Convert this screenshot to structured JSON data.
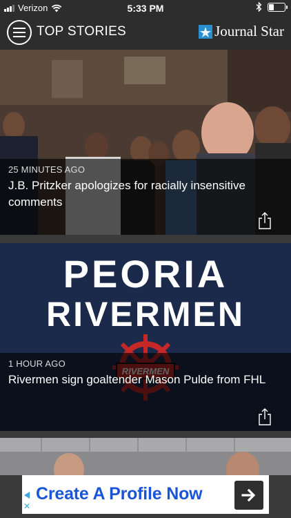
{
  "status_bar": {
    "carrier": "Verizon",
    "time": "5:33 PM",
    "battery_level": 0.35,
    "icons": [
      "signal-icon",
      "wifi-icon",
      "bluetooth-icon",
      "battery-icon"
    ]
  },
  "nav": {
    "title": "TOP STORIES",
    "logo_text": "Journal Star",
    "menu_icon": "hamburger-menu-icon",
    "logo_color": "#2a8fd0"
  },
  "stories": [
    {
      "time_ago": "25 MINUTES AGO",
      "headline": "J.B. Pritzker apologizes for racially insensitive comments",
      "image": "press-conference-photo",
      "share_icon": "share-icon"
    },
    {
      "time_ago": "1 HOUR AGO",
      "headline": "Rivermen sign goaltender Mason Pulde from FHL",
      "image_title_line1": "PEORIA",
      "image_title_line2": "RIVERMEN",
      "image_logo_text": "RIVERMEN",
      "share_icon": "share-icon"
    },
    {
      "image": "meeting-room-photo"
    }
  ],
  "ad": {
    "text": "Create A Profile Now",
    "cta_icon": "arrow-right-icon",
    "ad_color": "#1a55d6"
  }
}
